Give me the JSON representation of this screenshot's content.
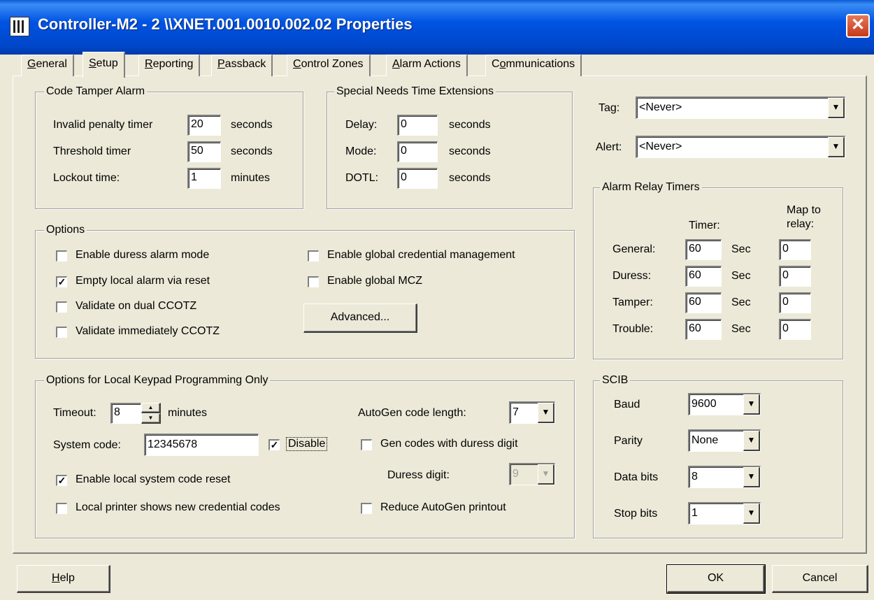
{
  "window": {
    "title": "Controller-M2 - 2 \\\\XNET.001.0010.002.02 Properties",
    "close_glyph": "✕"
  },
  "tabs": [
    {
      "label": "General",
      "mnemonic": "G",
      "rest": "eneral"
    },
    {
      "label": "Setup",
      "mnemonic": "S",
      "rest": "etup"
    },
    {
      "label": "Reporting",
      "mnemonic": "R",
      "rest": "eporting"
    },
    {
      "label": "Passback",
      "mnemonic": "P",
      "rest": "assback"
    },
    {
      "label": "Control Zones",
      "mnemonic": "C",
      "rest": "ontrol Zones"
    },
    {
      "label": "Alarm Actions",
      "mnemonic": "A",
      "rest": "larm Actions"
    },
    {
      "label": "Communications",
      "mnemonic": "o",
      "pre": "C",
      "rest": "mmunications"
    }
  ],
  "code_tamper": {
    "legend": "Code Tamper Alarm",
    "rows": [
      {
        "label": "Invalid penalty timer",
        "value": "20",
        "unit": "seconds"
      },
      {
        "label": "Threshold timer",
        "value": "50",
        "unit": "seconds"
      },
      {
        "label": "Lockout time:",
        "value": "1",
        "unit": "minutes"
      }
    ]
  },
  "special_needs": {
    "legend": "Special Needs Time Extensions",
    "rows": [
      {
        "label": "Delay:",
        "value": "0",
        "unit": "seconds"
      },
      {
        "label": "Mode:",
        "value": "0",
        "unit": "seconds"
      },
      {
        "label": "DOTL:",
        "value": "0",
        "unit": "seconds"
      }
    ]
  },
  "tag": {
    "label": "Tag:",
    "value": "<Never>"
  },
  "alert": {
    "label": "Alert:",
    "value": "<Never>"
  },
  "options": {
    "legend": "Options",
    "left": [
      {
        "label": "Enable duress alarm mode",
        "checked": false,
        "mark": ""
      },
      {
        "label": "Empty local alarm via reset",
        "checked": true,
        "mark": "✓"
      },
      {
        "label": "Validate on dual CCOTZ",
        "checked": false,
        "mark": ""
      },
      {
        "label": "Validate immediately CCOTZ",
        "checked": false,
        "mark": ""
      }
    ],
    "right": [
      {
        "label": "Enable global credential management",
        "checked": false,
        "mark": ""
      },
      {
        "label": "Enable global MCZ",
        "checked": false,
        "mark": ""
      }
    ],
    "advanced_label": "Advanced..."
  },
  "alarm_relay": {
    "legend": "Alarm Relay Timers",
    "timer_header": "Timer:",
    "map_header_1": "Map to",
    "map_header_2": "relay:",
    "rows": [
      {
        "label": "General:",
        "timer": "60",
        "unit": "Sec",
        "relay": "0"
      },
      {
        "label": "Duress:",
        "timer": "60",
        "unit": "Sec",
        "relay": "0"
      },
      {
        "label": "Tamper:",
        "timer": "60",
        "unit": "Sec",
        "relay": "0"
      },
      {
        "label": "Trouble:",
        "timer": "60",
        "unit": "Sec",
        "relay": "0"
      }
    ]
  },
  "keypad": {
    "legend": "Options for Local Keypad Programming Only",
    "timeout_label": "Timeout:",
    "timeout_value": "8",
    "timeout_unit": "minutes",
    "system_code_label": "System code:",
    "system_code_value": "12345678",
    "disable": {
      "label": "Disable",
      "checked": true,
      "mark": "✓"
    },
    "enable_reset": {
      "label": "Enable local system code reset",
      "checked": true,
      "mark": "✓"
    },
    "printer_shows": {
      "label": "Local printer shows new credential codes",
      "checked": false,
      "mark": ""
    },
    "autogen_label": "AutoGen code length:",
    "autogen_value": "7",
    "gen_duress": {
      "label": "Gen codes with duress digit",
      "checked": false,
      "mark": ""
    },
    "duress_digit_label": "Duress digit:",
    "duress_digit_value": "9",
    "reduce_printout": {
      "label": "Reduce AutoGen printout",
      "checked": false,
      "mark": ""
    }
  },
  "scib": {
    "legend": "SCIB",
    "rows": [
      {
        "label": "Baud",
        "value": "9600"
      },
      {
        "label": "Parity",
        "value": "None"
      },
      {
        "label": "Data bits",
        "value": "8"
      },
      {
        "label": "Stop bits",
        "value": "1"
      }
    ]
  },
  "footer": {
    "help_mnemonic": "H",
    "help_rest": "elp",
    "ok_label": "OK",
    "cancel_label": "Cancel"
  },
  "icons": {
    "dropdown": "▼",
    "spin_up": "▲",
    "spin_down": "▼"
  }
}
